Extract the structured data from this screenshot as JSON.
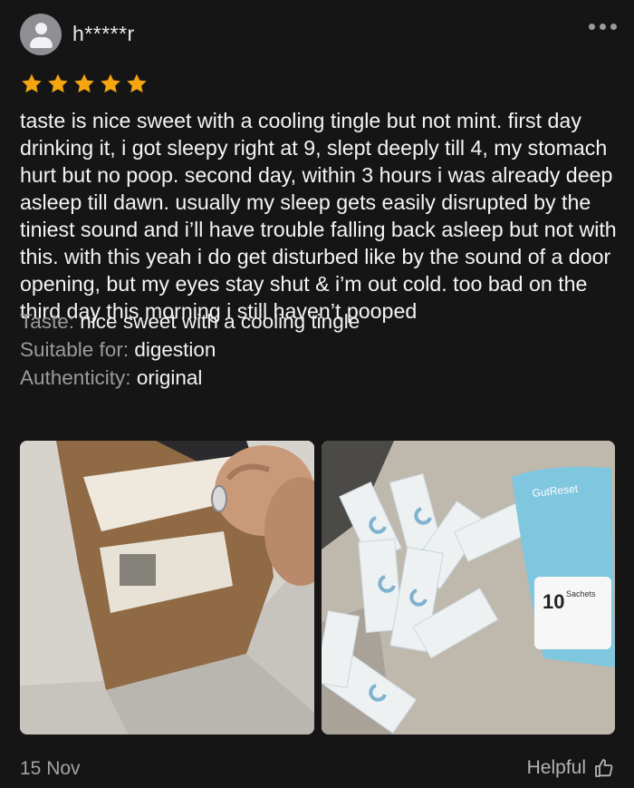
{
  "review": {
    "username": "h*****r",
    "rating": 5,
    "star_color": "#F4A50F",
    "text": "taste is nice sweet with a cooling tingle but not mint. first day drinking it, i got sleepy right at 9, slept deeply till 4, my stomach hurt but no poop. second day, within 3 hours i was already deep asleep till dawn. usually my sleep gets easily disrupted by the tiniest sound and i’ll have trouble falling back asleep but not with this. with this yeah i do get disturbed like by the sound of a door opening, but my eyes stay shut & i’m out cold. too bad on the third day this morning i still haven’t pooped",
    "attributes": [
      {
        "label": "Taste:",
        "value": "nice sweet with a cooling tingle"
      },
      {
        "label": "Suitable for:",
        "value": "digestion"
      },
      {
        "label": "Authenticity:",
        "value": "original"
      }
    ],
    "date": "15 Nov",
    "helpful_label": "Helpful"
  },
  "icons": {
    "avatar": "user-avatar-icon",
    "more": "more-options-icon",
    "helpful": "thumbs-up-icon"
  },
  "photos": {
    "photo2_packet_brand": "GutReset",
    "photo2_packet_count": "10",
    "photo2_packet_unit": "Sachets"
  }
}
